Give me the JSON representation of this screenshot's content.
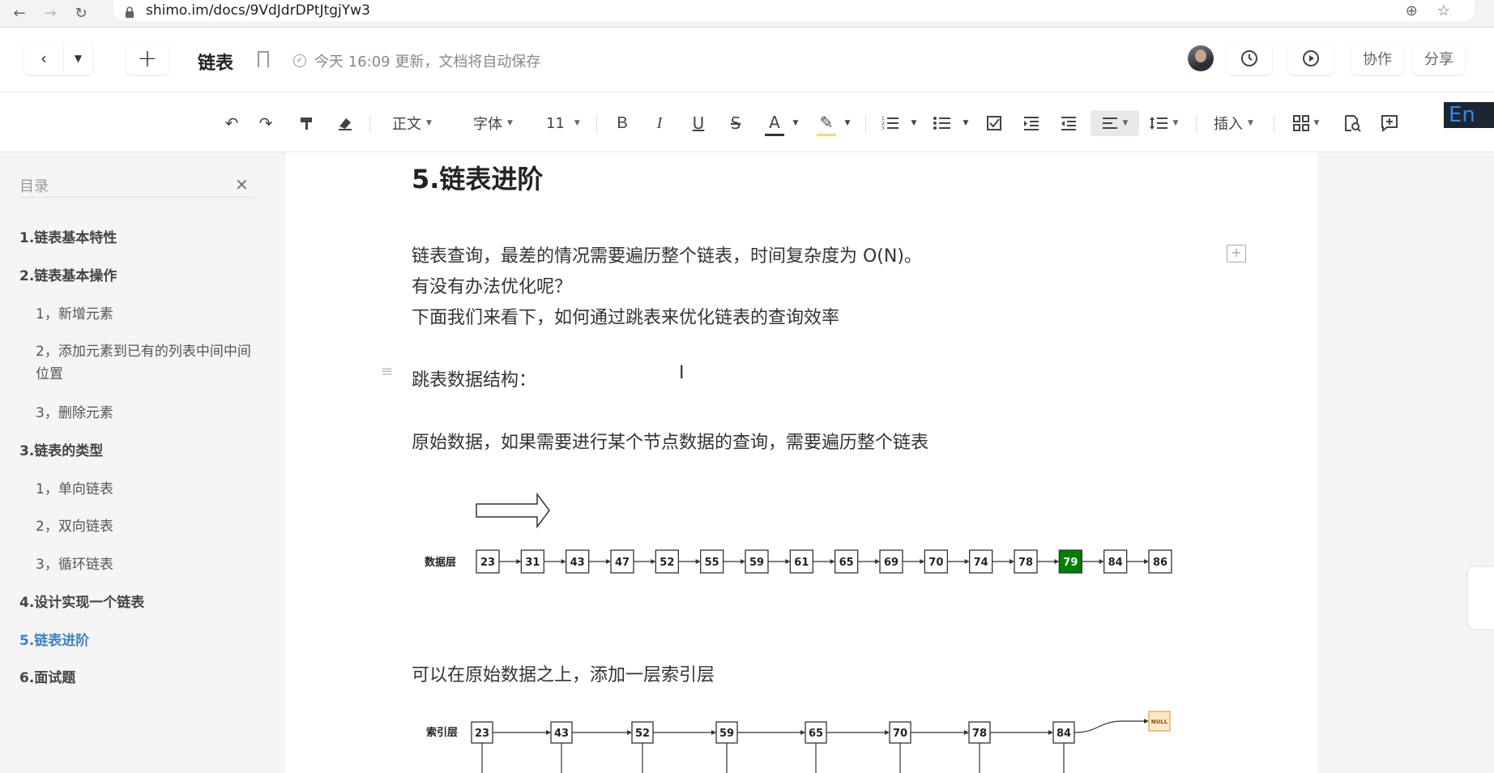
{
  "browser": {
    "url": "shimo.im/docs/9VdJdrDPtJtgjYw3"
  },
  "header": {
    "doc_title": "链表",
    "save_status": "今天 16:09 更新，文档将自动保存",
    "collab_label": "协作",
    "share_label": "分享"
  },
  "toolbar": {
    "style_label": "正文",
    "font_label": "字体",
    "size_label": "11",
    "insert_label": "插入",
    "ime_label": "En"
  },
  "toc": {
    "title": "目录",
    "items": [
      {
        "label": "1.链表基本特性",
        "level": 1
      },
      {
        "label": "2.链表基本操作",
        "level": 1
      },
      {
        "label": "1，新增元素",
        "level": 2
      },
      {
        "label": "2，添加元素到已有的列表中间中间位置",
        "level": 2
      },
      {
        "label": "3，删除元素",
        "level": 2
      },
      {
        "label": "3.链表的类型",
        "level": 1
      },
      {
        "label": "1，单向链表",
        "level": 2
      },
      {
        "label": "2，双向链表",
        "level": 2
      },
      {
        "label": "3，循环链表",
        "level": 2
      },
      {
        "label": "4.设计实现一个链表",
        "level": 1
      },
      {
        "label": "5.链表进阶",
        "level": 1,
        "active": true
      },
      {
        "label": "6.面试题",
        "level": 1
      }
    ]
  },
  "document": {
    "heading": "5.链表进阶",
    "p1": "链表查询，最差的情况需要遍历整个链表，时间复杂度为 O(N)。",
    "p2": "有没有办法优化呢？",
    "p3": "下面我们来看下，如何通过跳表来优化链表的查询效率",
    "p4": "跳表数据结构：",
    "p5": "原始数据，如果需要进行某个节点数据的查询，需要遍历整个链表",
    "p6": "可以在原始数据之上，添加一层索引层"
  },
  "diagram1": {
    "layer_label": "数据层",
    "nodes": [
      "23",
      "31",
      "43",
      "47",
      "52",
      "55",
      "59",
      "61",
      "65",
      "69",
      "70",
      "74",
      "78",
      "79",
      "84",
      "86"
    ],
    "highlight": "79",
    "highlight_color": "#008000"
  },
  "diagram2": {
    "layer_label": "索引层",
    "nodes": [
      "23",
      "43",
      "52",
      "59",
      "65",
      "70",
      "78",
      "84"
    ],
    "null_label": "NULL",
    "null_color": "#fde9c8"
  },
  "colors": {
    "accent": "#3b82c4"
  }
}
